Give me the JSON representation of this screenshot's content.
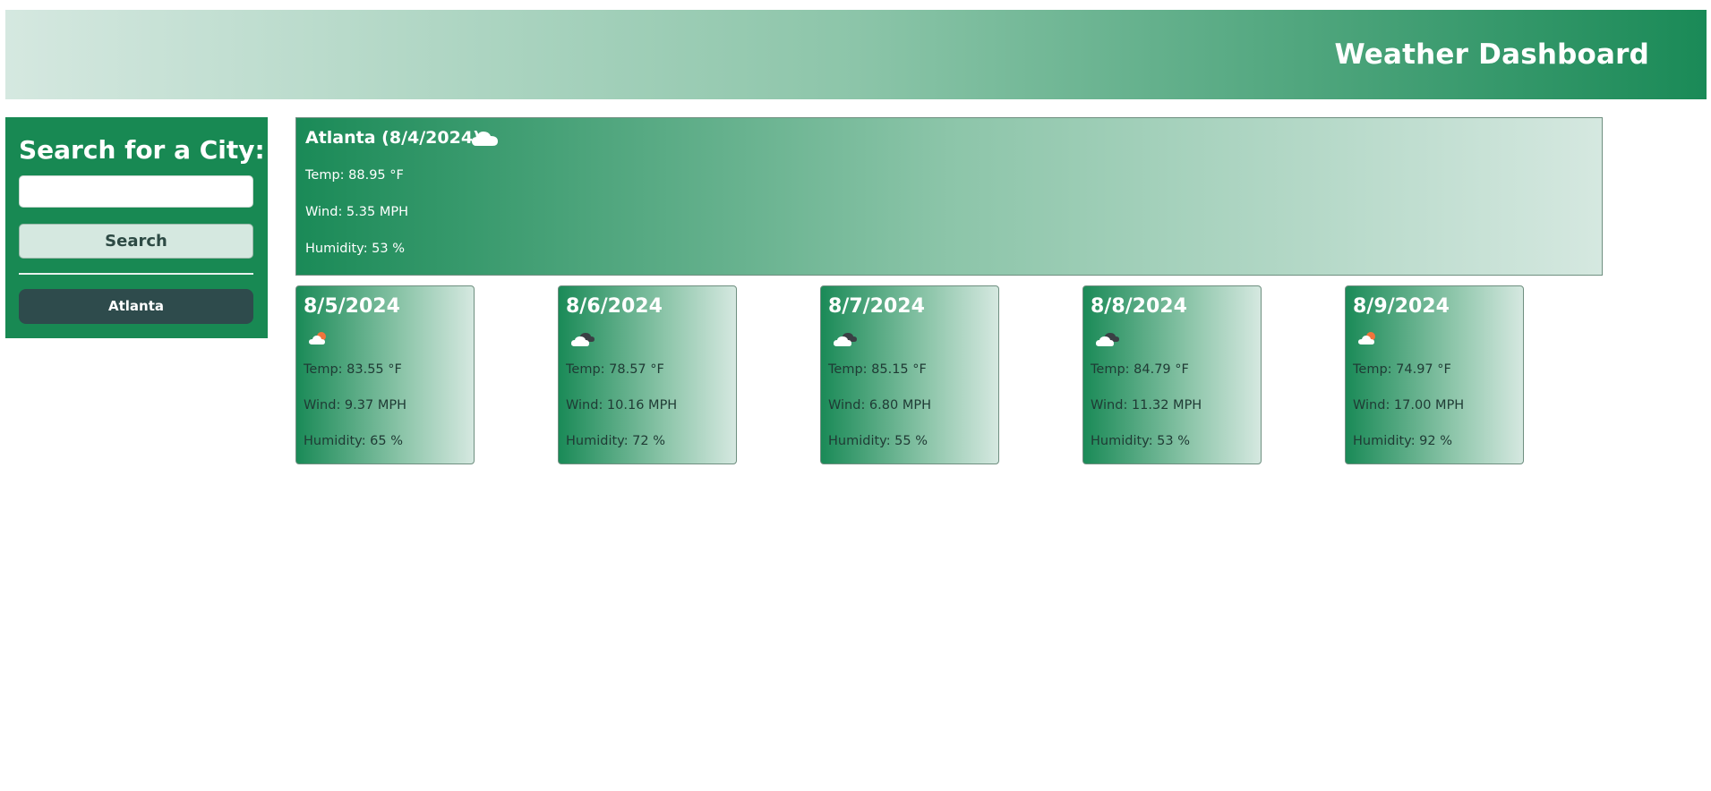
{
  "header": {
    "title": "Weather Dashboard"
  },
  "sidebar": {
    "title": "Search for a City:",
    "search_input": {
      "value": "",
      "placeholder": ""
    },
    "search_button_label": "Search",
    "history": [
      {
        "label": "Atlanta"
      }
    ]
  },
  "current": {
    "title": "Atlanta (8/4/2024)",
    "icon": "cloud-icon",
    "temp": "Temp: 88.95 °F",
    "wind": "Wind: 5.35 MPH",
    "humidity": "Humidity: 53 %"
  },
  "forecast": [
    {
      "date": "8/5/2024",
      "icon": "partly-cloudy-sun-icon",
      "temp": "Temp: 83.55 °F",
      "wind": "Wind: 9.37 MPH",
      "humidity": "Humidity: 65 %"
    },
    {
      "date": "8/6/2024",
      "icon": "dark-clouds-icon",
      "temp": "Temp: 78.57 °F",
      "wind": "Wind: 10.16 MPH",
      "humidity": "Humidity: 72 %"
    },
    {
      "date": "8/7/2024",
      "icon": "dark-clouds-icon",
      "temp": "Temp: 85.15 °F",
      "wind": "Wind: 6.80 MPH",
      "humidity": "Humidity: 55 %"
    },
    {
      "date": "8/8/2024",
      "icon": "dark-clouds-icon",
      "temp": "Temp: 84.79 °F",
      "wind": "Wind: 11.32 MPH",
      "humidity": "Humidity: 53 %"
    },
    {
      "date": "8/9/2024",
      "icon": "partly-cloudy-sun-icon",
      "temp": "Temp: 74.97 °F",
      "wind": "Wind: 17.00 MPH",
      "humidity": "Humidity: 92 %"
    }
  ],
  "colors": {
    "brand_green": "#188953",
    "light_green": "#d5e8e0",
    "dark_slate": "#2e4b4c"
  }
}
